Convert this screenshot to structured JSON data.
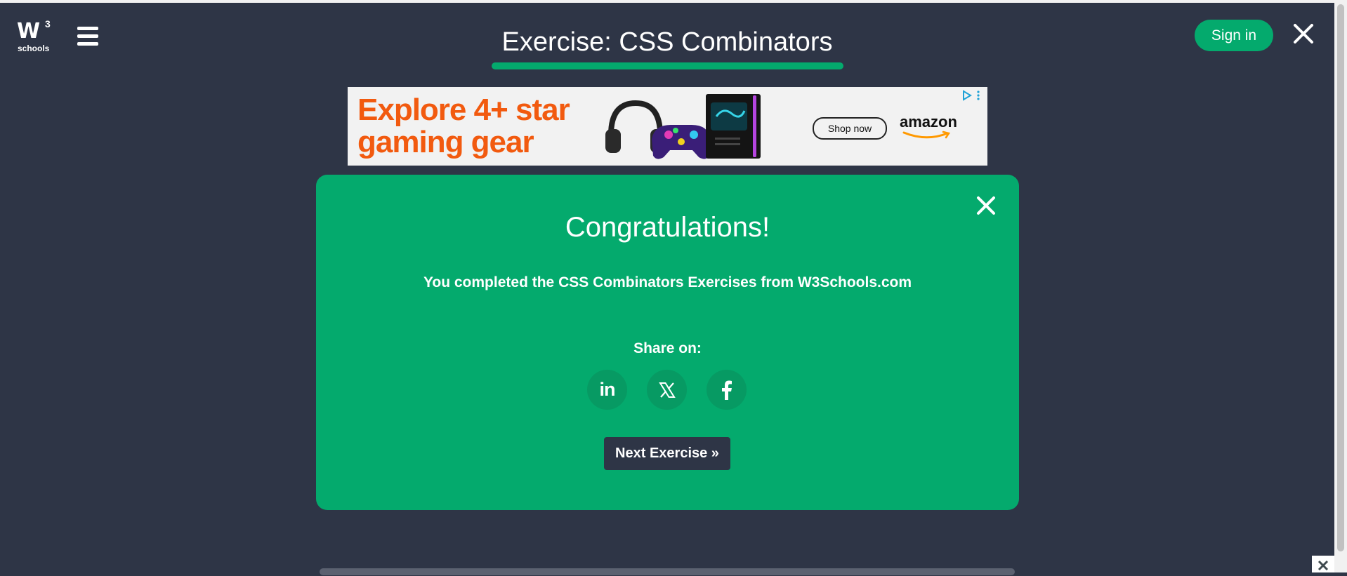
{
  "header": {
    "logo_main": "W",
    "logo_sup": "3",
    "logo_sub": "schools",
    "title": "Exercise: CSS Combinators",
    "signin_label": "Sign in"
  },
  "ad": {
    "headline_line1": "Explore 4+ star",
    "headline_line2": "gaming gear",
    "cta_label": "Shop now",
    "brand": "amazon"
  },
  "modal": {
    "heading": "Congratulations!",
    "message": "You completed the CSS Combinators Exercises from W3Schools.com",
    "share_label": "Share on:",
    "share_networks": [
      "LinkedIn",
      "X",
      "Facebook"
    ],
    "linkedin_glyph": "in",
    "next_label": "Next Exercise »"
  },
  "colors": {
    "background": "#2e3546",
    "accent": "#04aa6d",
    "ad_orange": "#f25a0f"
  }
}
